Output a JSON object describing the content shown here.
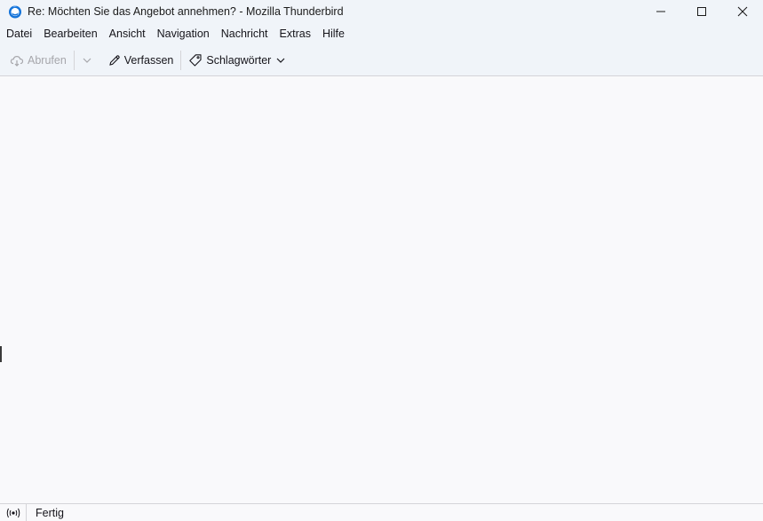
{
  "window": {
    "title": "Re: Möchten Sie das Angebot annehmen? - Mozilla Thunderbird",
    "controls": [
      {
        "name": "minimize-icon"
      },
      {
        "name": "maximize-icon"
      },
      {
        "name": "close-icon"
      }
    ]
  },
  "menubar": {
    "items": [
      "Datei",
      "Bearbeiten",
      "Ansicht",
      "Navigation",
      "Nachricht",
      "Extras",
      "Hilfe"
    ]
  },
  "toolbar": {
    "get_messages_label": "Abrufen",
    "get_messages_icon": "cloud-download-icon",
    "get_messages_enabled": false,
    "write_label": "Verfassen",
    "write_icon": "pencil-icon",
    "tags_label": "Schlagwörter",
    "tags_icon": "tag-icon"
  },
  "statusbar": {
    "icon": "online-status-icon",
    "text": "Fertig"
  },
  "colors": {
    "chrome": "#f0f4f9",
    "content": "#f9f9fb",
    "brand_blue": "#1373d9"
  }
}
